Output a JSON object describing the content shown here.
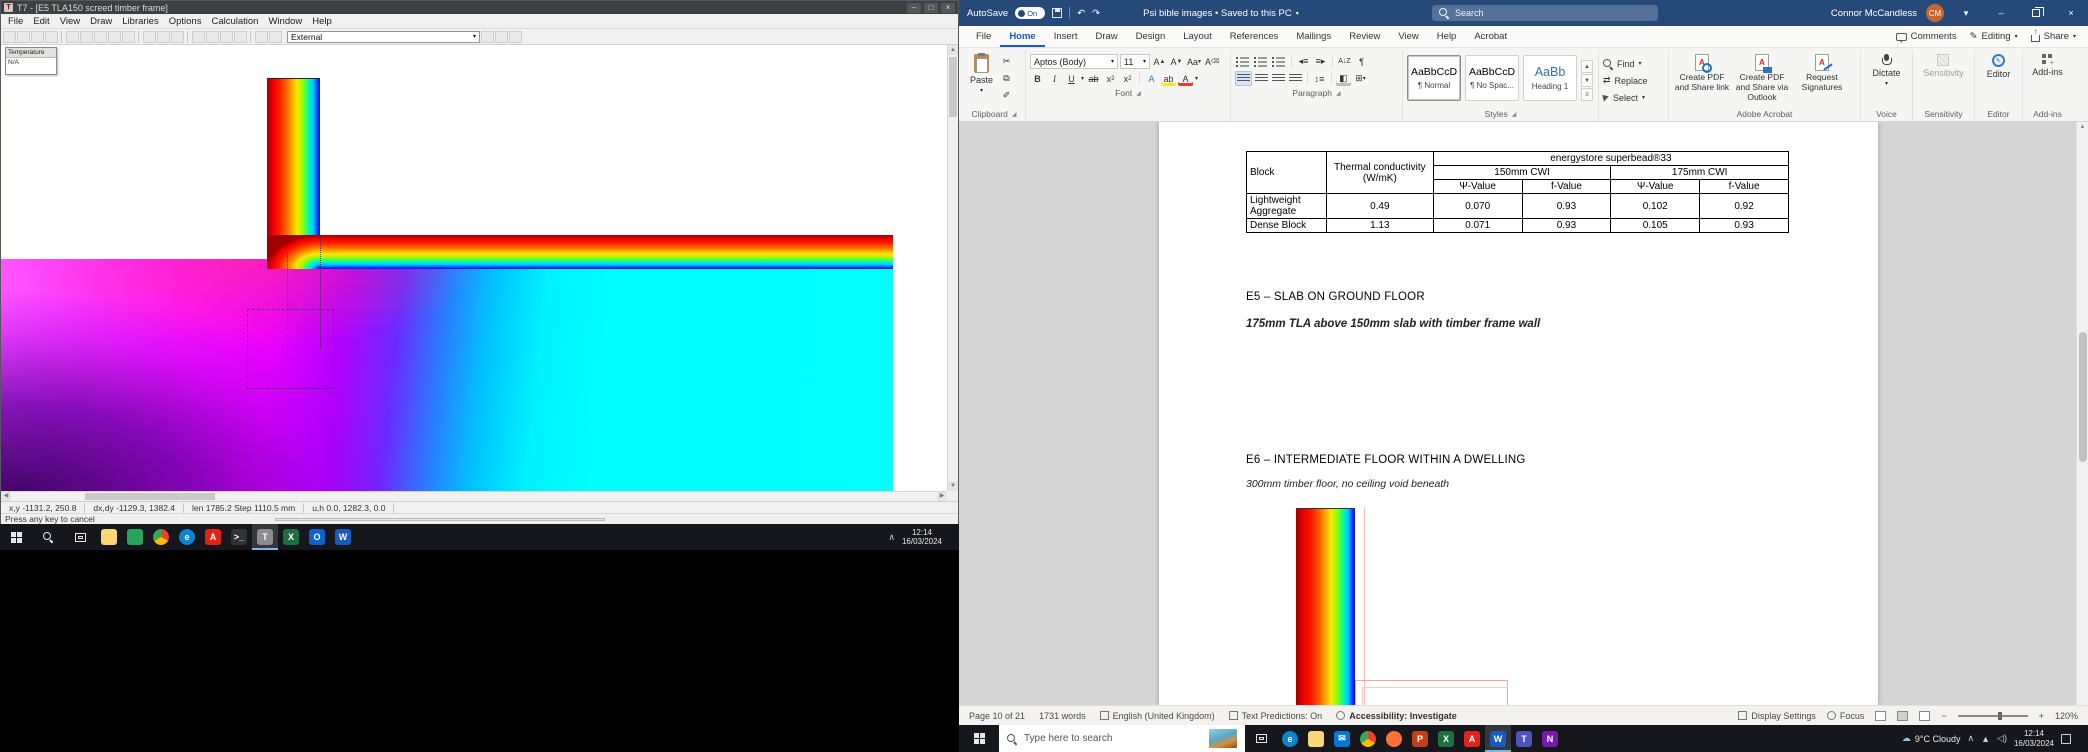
{
  "left_monitor": {
    "therm": {
      "title": "T7 - [E5 TLA150 screed timber frame]",
      "menus": [
        "File",
        "Edit",
        "View",
        "Draw",
        "Libraries",
        "Options",
        "Calculation",
        "Window",
        "Help"
      ],
      "toolbar": {
        "boundary_combo": "External"
      },
      "legend": {
        "title": "Temperature",
        "value": "N/A"
      },
      "statusbar": {
        "xy": "x,y  -1131.2, 250.8",
        "dxdy": "dx,dy  -1129.3, 1382.4",
        "len": "len  1785.2   Step 1110.5 mm",
        "uh": "u,h  0.0, 1282.3, 0.0"
      },
      "hint": "Press any key to cancel",
      "colors": {
        "hot": "#ff1500",
        "warm": "#ffe400",
        "cold": "#2a00e0",
        "ground_warm": "#ff00ff",
        "ground_cold": "#00ffff"
      }
    },
    "taskbar": {
      "time": "12:14",
      "date": "16/03/2024",
      "icons": [
        "file-explorer",
        "photos",
        "chrome",
        "edge",
        "acrobat",
        "console",
        "therm",
        "excel",
        "outlook",
        "word"
      ]
    }
  },
  "right_monitor": {
    "word": {
      "titlebar": {
        "autosave_label": "AutoSave",
        "autosave_state": "On",
        "doc_title": "Psi bible images • Saved to this PC",
        "search_placeholder": "Search",
        "user_name": "Connor McCandless",
        "user_initials": "CM"
      },
      "tabs": [
        "File",
        "Home",
        "Insert",
        "Draw",
        "Design",
        "Layout",
        "References",
        "Mailings",
        "Review",
        "View",
        "Help",
        "Acrobat"
      ],
      "active_tab": "Home",
      "top_right": {
        "comments": "Comments",
        "editing": "Editing",
        "share": "Share"
      },
      "ribbon": {
        "clipboard": {
          "paste": "Paste",
          "label": "Clipboard"
        },
        "font": {
          "family": "Aptos (Body)",
          "size": "11",
          "label": "Font"
        },
        "paragraph": {
          "label": "Paragraph"
        },
        "styles": {
          "label": "Styles",
          "items": [
            {
              "preview": "AaBbCcD",
              "name": "¶ Normal"
            },
            {
              "preview": "AaBbCcD",
              "name": "¶ No Spac..."
            },
            {
              "preview": "AaBb",
              "name": "Heading 1"
            }
          ]
        },
        "editing": {
          "find": "Find",
          "replace": "Replace",
          "select": "Select"
        },
        "acrobat": {
          "label": "Adobe Acrobat",
          "create_share_link": "Create PDF and Share link",
          "create_share_outlook": "Create PDF and Share via Outlook",
          "request_signatures": "Request Signatures"
        },
        "voice": {
          "dictate": "Dictate",
          "label": "Voice"
        },
        "sensitivity": {
          "button": "Sensitivity",
          "label": "Sensitivity"
        },
        "editor": {
          "button": "Editor",
          "label": "Editor"
        },
        "addins": {
          "button": "Add-ins",
          "label": "Add-ins"
        }
      },
      "document": {
        "table": {
          "header": {
            "block": "Block",
            "conductivity": "Thermal conductivity (W/mK)",
            "product": "energystore superbead®33",
            "cwi_150": "150mm CWI",
            "cwi_175": "175mm CWI",
            "psi": "Ψ-Value",
            "f": "f-Value"
          },
          "rows": [
            {
              "block": "Lightweight Aggregate",
              "conductivity": "0.49",
              "psi_150": "0.070",
              "f_150": "0.93",
              "psi_175": "0.102",
              "f_175": "0.92"
            },
            {
              "block": "Dense Block",
              "conductivity": "1.13",
              "psi_150": "0.071",
              "f_150": "0.93",
              "psi_175": "0.105",
              "f_175": "0.93"
            }
          ]
        },
        "heading_e5": "E5 – SLAB ON GROUND FLOOR",
        "subtitle_e5": "175mm TLA above 150mm slab with timber frame wall",
        "heading_e6": "E6 – INTERMEDIATE FLOOR WITHIN A DWELLING",
        "subtitle_e6": "300mm timber floor, no ceiling void beneath"
      },
      "statusbar": {
        "page": "Page 10 of 21",
        "words": "1731 words",
        "language": "English (United Kingdom)",
        "predictions": "Text Predictions: On",
        "accessibility": "Accessibility: Investigate",
        "display_settings": "Display Settings",
        "focus": "Focus",
        "zoom": "120%"
      },
      "colors": {
        "accent": "#185abd",
        "titlebar": "#254a7a",
        "avatar": "#c9652f"
      }
    },
    "taskbar": {
      "search_placeholder": "Type here to search",
      "weather": "9°C Cloudy",
      "time": "12:14",
      "date": "16/03/2024",
      "icons": [
        "edge",
        "file-explorer",
        "mail",
        "chrome",
        "firefox",
        "powerpoint",
        "excel",
        "acrobat",
        "word",
        "teams",
        "onenote"
      ]
    }
  }
}
